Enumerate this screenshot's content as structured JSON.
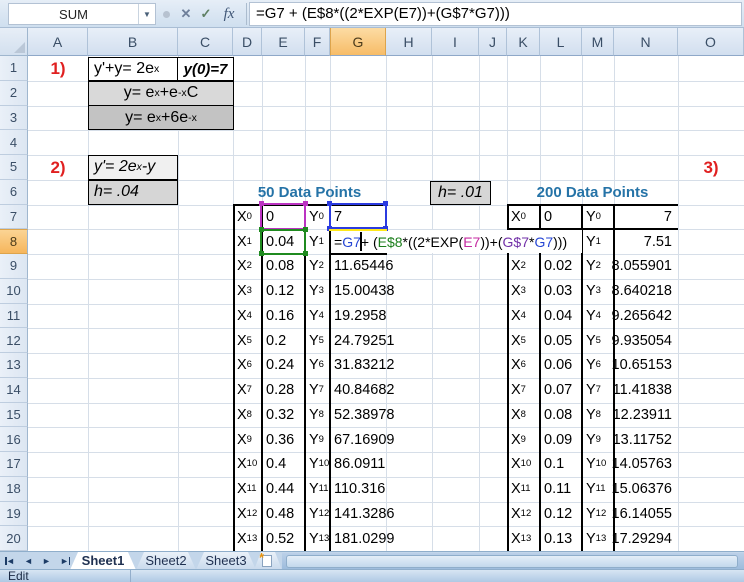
{
  "formula_bar": {
    "name_box": "SUM",
    "formula": "=G7 + (E$8*((2*EXP(E7))+(G$7*G7)))"
  },
  "icons": {
    "name_dropdown": "▼",
    "cancel": "✕",
    "enter": "✓",
    "insert_function": "fx",
    "nav_prev": "◄",
    "nav_next": "►",
    "insert_sheet": "*"
  },
  "grid": {
    "columns": [
      "A",
      "B",
      "C",
      "D",
      "E",
      "F",
      "G",
      "H",
      "I",
      "J",
      "K",
      "L",
      "M",
      "N",
      "O"
    ],
    "row_labels": [
      "1",
      "2",
      "3",
      "4",
      "5",
      "6",
      "7",
      "8",
      "9",
      "10",
      "11",
      "12",
      "13",
      "14",
      "15",
      "16",
      "17",
      "18",
      "19",
      "20"
    ],
    "selection": {
      "column": "G",
      "row": "8"
    }
  },
  "cells": {
    "label1": "1)",
    "eq_main": "y'+y= 2e^{x}",
    "init_cond": "y(0)=7",
    "eq_general": "y= e^{x}+e^{-x}C",
    "eq_particular": "y= e^{x}+6e^{-x}",
    "label2": "2)",
    "eq_prime": "y'= 2e^{x} -y",
    "h_left": "h= .04",
    "h_right": "h= .01",
    "label3": "3)"
  },
  "table_50": {
    "title": "50 Data Points",
    "rows": [
      {
        "xl": "X_{0}",
        "xv": "0",
        "yl": "Y_{0}",
        "yv": "7"
      },
      {
        "xl": "X_{1}",
        "xv": "0.04",
        "yl": "Y_{1}",
        "yv": ""
      },
      {
        "xl": "X_{2}",
        "xv": "0.08",
        "yl": "Y_{2}",
        "yv": "11.65446"
      },
      {
        "xl": "X_{3}",
        "xv": "0.12",
        "yl": "Y_{3}",
        "yv": "15.00438"
      },
      {
        "xl": "X_{4}",
        "xv": "0.16",
        "yl": "Y_{4}",
        "yv": "19.2958"
      },
      {
        "xl": "X_{5}",
        "xv": "0.2",
        "yl": "Y_{5}",
        "yv": "24.79251"
      },
      {
        "xl": "X_{6}",
        "xv": "0.24",
        "yl": "Y_{6}",
        "yv": "31.83212"
      },
      {
        "xl": "X_{7}",
        "xv": "0.28",
        "yl": "Y_{7}",
        "yv": "40.84682"
      },
      {
        "xl": "X_{8}",
        "xv": "0.32",
        "yl": "Y_{8}",
        "yv": "52.38978"
      },
      {
        "xl": "X_{9}",
        "xv": "0.36",
        "yl": "Y_{9}",
        "yv": "67.16909"
      },
      {
        "xl": "X_{10}",
        "xv": "0.4",
        "yl": "Y_{10}",
        "yv": "86.0911"
      },
      {
        "xl": "X_{11}",
        "xv": "0.44",
        "yl": "Y_{11}",
        "yv": "110.316"
      },
      {
        "xl": "X_{12}",
        "xv": "0.48",
        "yl": "Y_{12}",
        "yv": "141.3286"
      },
      {
        "xl": "X_{13}",
        "xv": "0.52",
        "yl": "Y_{13}",
        "yv": "181.0299"
      }
    ]
  },
  "table_200": {
    "title": "200 Data Points",
    "rows": [
      {
        "xl": "X_{0}",
        "xv": "0",
        "yl": "Y_{0}",
        "yv": "7"
      },
      {
        "xl": "",
        "xv": "",
        "yl": "Y_{1}",
        "yv": "7.51"
      },
      {
        "xl": "X_{2}",
        "xv": "0.02",
        "yl": "Y_{2}",
        "yv": "8.055901"
      },
      {
        "xl": "X_{3}",
        "xv": "0.03",
        "yl": "Y_{3}",
        "yv": "8.640218"
      },
      {
        "xl": "X_{4}",
        "xv": "0.04",
        "yl": "Y_{4}",
        "yv": "9.265642"
      },
      {
        "xl": "X_{5}",
        "xv": "0.05",
        "yl": "Y_{5}",
        "yv": "9.935054"
      },
      {
        "xl": "X_{6}",
        "xv": "0.06",
        "yl": "Y_{6}",
        "yv": "10.65153"
      },
      {
        "xl": "X_{7}",
        "xv": "0.07",
        "yl": "Y_{7}",
        "yv": "11.41838"
      },
      {
        "xl": "X_{8}",
        "xv": "0.08",
        "yl": "Y_{8}",
        "yv": "12.23911"
      },
      {
        "xl": "X_{9}",
        "xv": "0.09",
        "yl": "Y_{9}",
        "yv": "13.11752"
      },
      {
        "xl": "X_{10}",
        "xv": "0.1",
        "yl": "Y_{10}",
        "yv": "14.05763"
      },
      {
        "xl": "X_{11}",
        "xv": "0.11",
        "yl": "Y_{11}",
        "yv": "15.06376"
      },
      {
        "xl": "X_{12}",
        "xv": "0.12",
        "yl": "Y_{12}",
        "yv": "16.14055"
      },
      {
        "xl": "X_{13}",
        "xv": "0.13",
        "yl": "Y_{13}",
        "yv": "17.29294"
      }
    ]
  },
  "cell_edit": {
    "segments": [
      {
        "t": "=",
        "c": "#000000"
      },
      {
        "t": "G7",
        "c": "#2646D4"
      },
      {
        "t": " + (",
        "c": "#000000"
      },
      {
        "t": "E$8",
        "c": "#1B7E1B"
      },
      {
        "t": "*((2*EXP(",
        "c": "#000000"
      },
      {
        "t": "E7",
        "c": "#C42AA0"
      },
      {
        "t": "))+(",
        "c": "#000000"
      },
      {
        "t": "G$7",
        "c": "#7230A8"
      },
      {
        "t": "*",
        "c": "#000000"
      },
      {
        "t": "G7",
        "c": "#2646D4"
      },
      {
        "t": ")))",
        "c": "#000000"
      }
    ]
  },
  "sheet_tabs": {
    "tabs": [
      "Sheet1",
      "Sheet2",
      "Sheet3"
    ],
    "active": "Sheet1"
  },
  "status_bar": {
    "mode": "Edit"
  },
  "colors": {
    "ref_blue": "#2646D4",
    "ref_green": "#1B7E1B",
    "ref_magenta": "#C42AA0",
    "ref_purple": "#7230A8",
    "highlight_yellow": "#FFE81A",
    "header_selected_orange": "#F7BC67",
    "title_blue": "#2573A7",
    "label_red": "#E02020"
  }
}
